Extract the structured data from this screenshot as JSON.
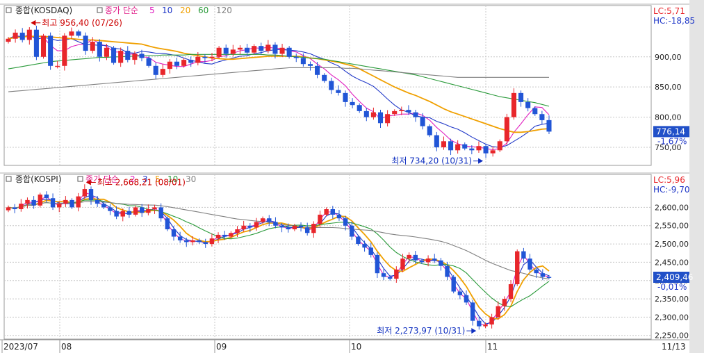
{
  "colors": {
    "up": "#e8262b",
    "down": "#2155d6",
    "ma_fast": "#e020c0",
    "ma_blue": "#2038c8",
    "ma_orange": "#f0a000",
    "ma_green": "#2a9a3a",
    "ma_gray": "#808080",
    "grid": "#c8c8c8",
    "title_pink": "#e0208a",
    "anno_red": "#cc0000",
    "anno_blue": "#1030c0"
  },
  "x_axis": {
    "labels": [
      "2023/07",
      "08",
      "09",
      "10",
      "11"
    ],
    "end_label": "11/13"
  },
  "chart_data": [
    {
      "type": "candlestick",
      "symbol": "종합(KOSDAQ)",
      "legend": {
        "label": "종가 단순",
        "periods": [
          "5",
          "10",
          "20",
          "60",
          "120"
        ]
      },
      "ylim": [
        720,
        985
      ],
      "yticks": [
        "900,00",
        "850,00",
        "800,00",
        "750,00"
      ],
      "ytick_values": [
        900,
        850,
        800,
        750
      ],
      "lc": "LC:5,71",
      "hc": "HC:-18,85",
      "last_price": "776,14",
      "change": "-1,67%",
      "high_annotation": "최고 956,40 (07/26)",
      "low_annotation": "최저 734,20 (10/31)",
      "high": 956.4,
      "low": 734.2,
      "closes": [
        930,
        940,
        928,
        945,
        900,
        935,
        885,
        885,
        935,
        942,
        935,
        910,
        925,
        900,
        915,
        890,
        910,
        895,
        905,
        898,
        885,
        870,
        880,
        892,
        885,
        895,
        890,
        900,
        898,
        900,
        915,
        905,
        912,
        915,
        907,
        918,
        910,
        920,
        905,
        915,
        900,
        898,
        888,
        885,
        870,
        860,
        845,
        840,
        825,
        820,
        810,
        800,
        808,
        790,
        805,
        810,
        812,
        808,
        800,
        785,
        770,
        750,
        760,
        745,
        755,
        748,
        745,
        752,
        740,
        745,
        760,
        800,
        840,
        825,
        815,
        805,
        795,
        776
      ],
      "ma": [
        {
          "period": "5",
          "values": [
            930,
            935,
            933,
            936,
            929,
            932,
            919,
            910,
            910,
            917,
            920,
            921,
            929,
            922,
            917,
            908,
            908,
            904,
            905,
            900,
            899,
            891,
            888,
            886,
            884,
            884,
            888,
            892,
            892,
            894,
            900,
            902,
            906,
            910,
            912,
            915,
            914,
            916,
            914,
            914,
            910,
            908,
            902,
            897,
            888,
            880,
            870,
            862,
            852,
            838,
            826,
            815,
            809,
            797,
            802,
            803,
            805,
            805,
            807,
            803,
            795,
            783,
            773,
            762,
            756,
            752,
            751,
            750,
            748,
            746,
            748,
            757,
            775,
            789,
            804,
            817,
            816,
            804
          ]
        },
        {
          "period": "10",
          "values": [
            930,
            935,
            933,
            936,
            929,
            932,
            930,
            927,
            928,
            930,
            925,
            920,
            920,
            919,
            919,
            914,
            913,
            907,
            906,
            909,
            908,
            906,
            906,
            904,
            902,
            898,
            894,
            892,
            889,
            888,
            892,
            895,
            898,
            901,
            902,
            905,
            907,
            910,
            912,
            912,
            911,
            910,
            908,
            905,
            900,
            896,
            890,
            885,
            876,
            868,
            862,
            857,
            851,
            841,
            830,
            820,
            812,
            808,
            802,
            800,
            799,
            793,
            789,
            784,
            780,
            774,
            767,
            761,
            755,
            751,
            750,
            753,
            760,
            767,
            775,
            785,
            788,
            790
          ]
        },
        {
          "period": "20",
          "values": [
            930,
            932,
            933,
            934,
            934,
            934,
            933,
            932,
            931,
            930,
            929,
            928,
            928,
            927,
            926,
            925,
            924,
            923,
            922,
            921,
            918,
            915,
            913,
            911,
            909,
            906,
            904,
            902,
            900,
            898,
            897,
            896,
            896,
            897,
            898,
            899,
            900,
            901,
            901,
            901,
            901,
            901,
            900,
            898,
            897,
            895,
            893,
            891,
            888,
            885,
            880,
            874,
            868,
            862,
            856,
            850,
            845,
            840,
            836,
            831,
            826,
            820,
            814,
            809,
            805,
            801,
            797,
            793,
            789,
            785,
            781,
            778,
            775,
            775,
            776,
            778,
            780,
            781
          ]
        },
        {
          "period": "60",
          "values": [
            880,
            882,
            884,
            886,
            888,
            890,
            892,
            893,
            894,
            895,
            896,
            897,
            898,
            899,
            899,
            900,
            900,
            901,
            901,
            902,
            902,
            902,
            903,
            903,
            903,
            903,
            904,
            904,
            904,
            904,
            904,
            904,
            904,
            904,
            904,
            904,
            904,
            903,
            903,
            902,
            901,
            900,
            899,
            898,
            897,
            896,
            894,
            892,
            890,
            888,
            886,
            884,
            882,
            880,
            878,
            876,
            874,
            872,
            870,
            867,
            864,
            861,
            858,
            855,
            852,
            849,
            846,
            843,
            840,
            837,
            834,
            832,
            830,
            828,
            826,
            824,
            821,
            818
          ]
        },
        {
          "period": "120",
          "values": [
            842,
            843,
            844,
            845,
            846,
            847,
            848,
            849,
            850,
            851,
            852,
            853,
            854,
            855,
            856,
            857,
            858,
            859,
            860,
            861,
            862,
            863,
            864,
            865,
            866,
            867,
            868,
            869,
            870,
            871,
            872,
            873,
            874,
            875,
            876,
            877,
            878,
            879,
            880,
            881,
            882,
            882,
            882,
            882,
            882,
            882,
            882,
            882,
            881,
            881,
            880,
            879,
            878,
            877,
            876,
            875,
            874,
            873,
            872,
            871,
            870,
            869,
            868,
            867,
            866,
            866,
            866,
            866,
            866,
            866,
            866,
            866,
            866,
            866,
            866,
            866,
            866,
            866
          ]
        }
      ]
    },
    {
      "type": "candlestick",
      "symbol": "종합(KOSPI)",
      "legend": {
        "label": "종가 단순",
        "periods": [
          "2",
          "3",
          "5",
          "10",
          "30"
        ]
      },
      "ylim": [
        2240,
        2690
      ],
      "yticks": [
        "2,600,00",
        "2,550,00",
        "2,500,00",
        "2,450,00",
        "2,400,00",
        "2,350,00",
        "2,300,00",
        "2,250,00"
      ],
      "ytick_values": [
        2600,
        2550,
        2500,
        2450,
        2400,
        2350,
        2300,
        2250
      ],
      "lc": "LC:5,96",
      "hc": "HC:-9,70",
      "last_price": "2,409,46",
      "change": "-0,01%",
      "high_annotation": "최고 2,668,21 (08/01)",
      "low_annotation": "최저 2,273,97 (10/31)",
      "high": 2668.21,
      "low": 2273.97,
      "closes": [
        2600,
        2595,
        2610,
        2620,
        2605,
        2635,
        2625,
        2600,
        2610,
        2620,
        2600,
        2630,
        2650,
        2620,
        2610,
        2600,
        2590,
        2575,
        2590,
        2580,
        2600,
        2585,
        2595,
        2600,
        2570,
        2540,
        2520,
        2510,
        2505,
        2510,
        2505,
        2500,
        2515,
        2525,
        2520,
        2530,
        2540,
        2550,
        2545,
        2560,
        2570,
        2560,
        2550,
        2545,
        2540,
        2550,
        2545,
        2530,
        2555,
        2580,
        2595,
        2580,
        2570,
        2550,
        2520,
        2500,
        2490,
        2470,
        2420,
        2410,
        2405,
        2430,
        2460,
        2470,
        2455,
        2450,
        2460,
        2455,
        2440,
        2410,
        2370,
        2360,
        2340,
        2290,
        2275,
        2280,
        2300,
        2330,
        2350,
        2390,
        2480,
        2460,
        2430,
        2420,
        2410,
        2409
      ]
    }
  ]
}
